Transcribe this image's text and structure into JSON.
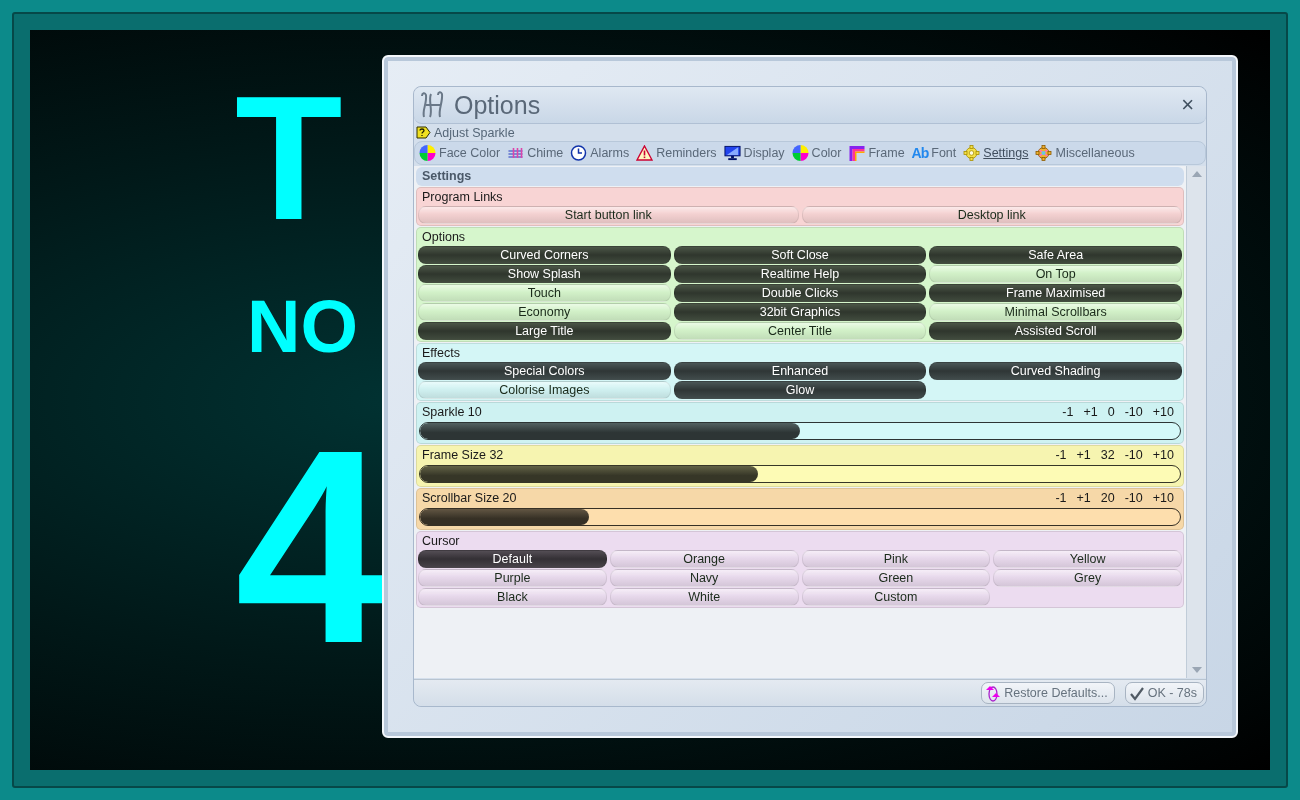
{
  "clock": {
    "day": "T",
    "month": "NO",
    "date": "4"
  },
  "dialog": {
    "title": "Options",
    "close": "×",
    "help": "Adjust Sparkle",
    "tabs": [
      {
        "label": "Face Color",
        "selected": false
      },
      {
        "label": "Chime",
        "selected": false
      },
      {
        "label": "Alarms",
        "selected": false
      },
      {
        "label": "Reminders",
        "selected": false
      },
      {
        "label": "Display",
        "selected": false
      },
      {
        "label": "Color",
        "selected": false
      },
      {
        "label": "Frame",
        "selected": false
      },
      {
        "label": "Font",
        "glyph": "Ab",
        "selected": false
      },
      {
        "label": "Settings",
        "selected": true
      },
      {
        "label": "Miscellaneous",
        "selected": false
      }
    ],
    "header": "Settings",
    "sections": [
      {
        "kind": "toggles",
        "title": "Program Links",
        "color": "#f8d4d4",
        "items": [
          {
            "label": "Start button link",
            "on": false
          },
          {
            "label": "Desktop link",
            "on": false
          }
        ]
      },
      {
        "kind": "toggles",
        "title": "Options",
        "color": "#d6f6cc",
        "items": [
          {
            "label": "Curved Corners",
            "on": true
          },
          {
            "label": "Soft Close",
            "on": true
          },
          {
            "label": "Safe Area",
            "on": true
          },
          {
            "label": "Show Splash",
            "on": true
          },
          {
            "label": "Realtime Help",
            "on": true
          },
          {
            "label": "On Top",
            "on": false
          },
          {
            "label": "Touch",
            "on": false
          },
          {
            "label": "Double Clicks",
            "on": true
          },
          {
            "label": "Frame Maximised",
            "on": true
          },
          {
            "label": "Economy",
            "on": false
          },
          {
            "label": "32bit Graphics",
            "on": true
          },
          {
            "label": "Minimal Scrollbars",
            "on": false
          },
          {
            "label": "Large Title",
            "on": true
          },
          {
            "label": "Center Title",
            "on": false
          },
          {
            "label": "Assisted Scroll",
            "on": true
          }
        ]
      },
      {
        "kind": "toggles",
        "title": "Effects",
        "color": "#d4f6f6",
        "items": [
          {
            "label": "Special Colors",
            "on": true
          },
          {
            "label": "Enhanced",
            "on": true
          },
          {
            "label": "Curved Shading",
            "on": true
          },
          {
            "label": "Colorise Images",
            "on": false
          },
          {
            "label": "Glow",
            "on": true
          }
        ]
      },
      {
        "kind": "slider",
        "title": "Sparkle 10",
        "color": "#cef2f2",
        "level": 0.5,
        "steps": [
          "-1",
          "+1",
          "0",
          "-10",
          "+10"
        ]
      },
      {
        "kind": "slider",
        "title": "Frame Size 32",
        "color": "#f6f4b0",
        "level": 0.445,
        "steps": [
          "-1",
          "+1",
          "32",
          "-10",
          "+10"
        ]
      },
      {
        "kind": "slider",
        "title": "Scrollbar Size 20",
        "color": "#f6d8a8",
        "level": 0.223,
        "steps": [
          "-1",
          "+1",
          "20",
          "-10",
          "+10"
        ]
      },
      {
        "kind": "choice",
        "title": "Cursor",
        "color": "#ecdcf0",
        "items": [
          {
            "label": "Default",
            "selected": true
          },
          {
            "label": "Orange",
            "selected": false
          },
          {
            "label": "Pink",
            "selected": false
          },
          {
            "label": "Yellow",
            "selected": false
          },
          {
            "label": "Purple",
            "selected": false
          },
          {
            "label": "Navy",
            "selected": false
          },
          {
            "label": "Green",
            "selected": false
          },
          {
            "label": "Grey",
            "selected": false
          },
          {
            "label": "Black",
            "selected": false
          },
          {
            "label": "White",
            "selected": false
          },
          {
            "label": "Custom",
            "selected": false
          }
        ]
      }
    ],
    "buttons": [
      {
        "kind": "restore",
        "label": "Restore Defaults..."
      },
      {
        "kind": "ok",
        "label": "OK - 78s"
      }
    ]
  }
}
